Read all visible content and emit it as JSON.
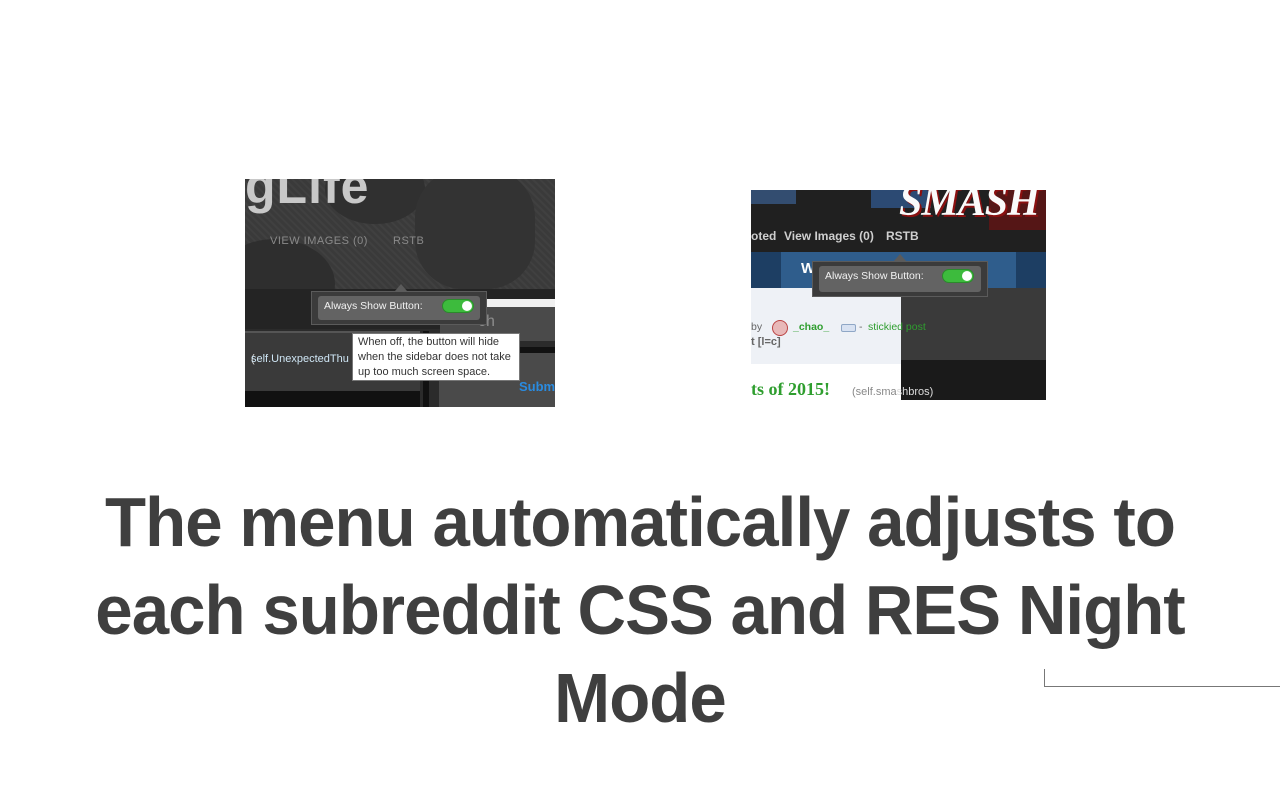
{
  "left_screenshot": {
    "logo_text": "gLife",
    "nav_items": [
      "VIEW IMAGES (0)",
      "RSTB"
    ],
    "search_text": "ch",
    "content_text": "self.UnexpectedThu",
    "content_paren": "(",
    "submit_text": "Subm",
    "toggle_label": "Always Show Button:",
    "toggle_state": "on",
    "tooltip": "When off, the button will hide when the sidebar does not take up too much screen space."
  },
  "right_screenshot": {
    "logo_text": "SMASH",
    "nav_items": [
      "oted",
      "View Images (0)",
      "RSTB"
    ],
    "band_text_left": "W",
    "band_text_right": "l",
    "toggle_label": "Always Show Button:",
    "toggle_state": "on",
    "post_by": "by",
    "username": "_chao_",
    "dash": "-",
    "sticky": "stickied post",
    "comments": "t   [l=c]",
    "post_title": "ts of 2015!",
    "domain_prefix": "(self.sma",
    "domain_suffix": "shbros)"
  },
  "caption": {
    "line1": "The menu automatically adjusts to",
    "line2": "each subreddit CSS and RES Night Mode"
  },
  "colors": {
    "toggle_on": "#3dbb3d",
    "caption": "#3f3f3f"
  }
}
